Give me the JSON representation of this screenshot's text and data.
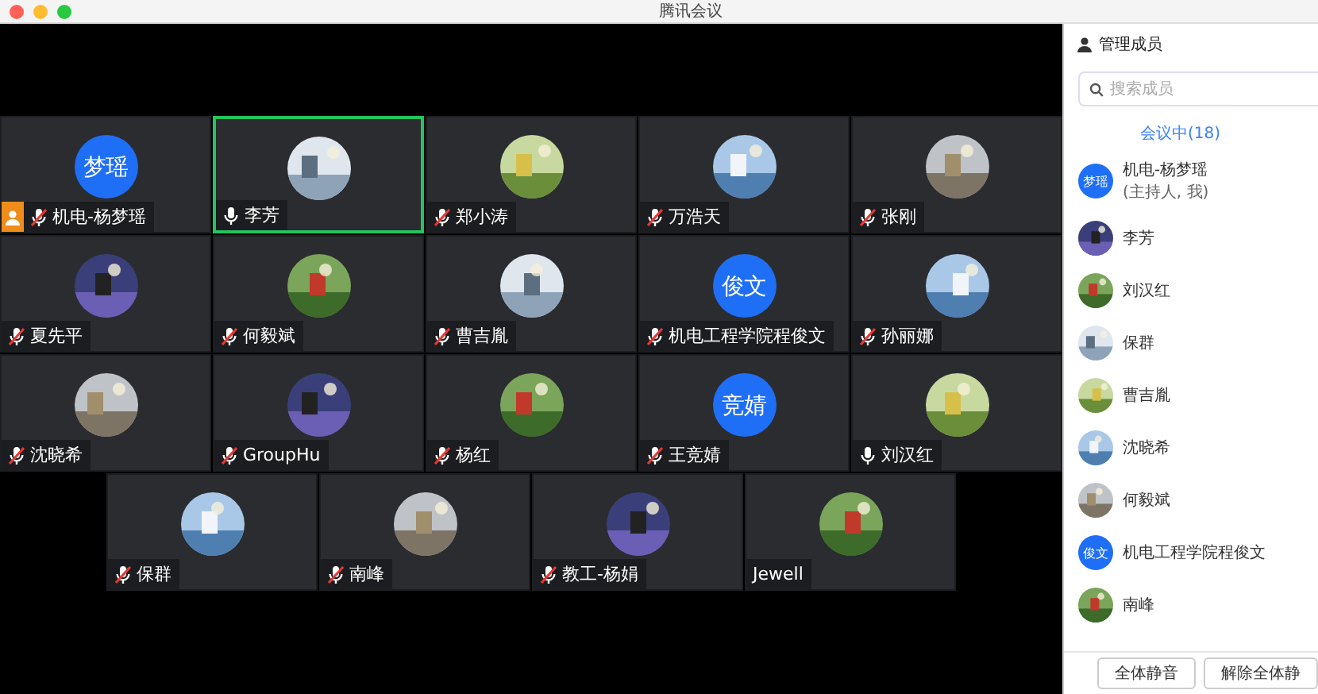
{
  "window": {
    "title": "腾讯会议"
  },
  "grid_rows": [
    {
      "tiles": [
        {
          "name": "机电-杨梦瑶",
          "avatar": {
            "kind": "text",
            "text": "梦瑶"
          },
          "host": true,
          "mic_muted": true,
          "active_speaker": false
        },
        {
          "name": "李芳",
          "host": false,
          "mic_muted": false,
          "active_speaker": true
        },
        {
          "name": "郑小涛",
          "host": false,
          "mic_muted": true,
          "active_speaker": false
        },
        {
          "name": "万浩天",
          "host": false,
          "mic_muted": true,
          "active_speaker": false
        },
        {
          "name": "张刚",
          "host": false,
          "mic_muted": true,
          "active_speaker": false
        }
      ]
    },
    {
      "tiles": [
        {
          "name": "夏先平",
          "host": false,
          "mic_muted": true,
          "active_speaker": false
        },
        {
          "name": "何毅斌",
          "host": false,
          "mic_muted": true,
          "active_speaker": false
        },
        {
          "name": "曹吉胤",
          "host": false,
          "mic_muted": true,
          "active_speaker": false
        },
        {
          "name": "机电工程学院程俊文",
          "avatar": {
            "kind": "text",
            "text": "俊文"
          },
          "host": false,
          "mic_muted": true,
          "active_speaker": false
        },
        {
          "name": "孙丽娜",
          "host": false,
          "mic_muted": true,
          "active_speaker": false
        }
      ]
    },
    {
      "tiles": [
        {
          "name": "沈晓希",
          "host": false,
          "mic_muted": true,
          "active_speaker": false
        },
        {
          "name": "GroupHu",
          "host": false,
          "mic_muted": true,
          "active_speaker": false
        },
        {
          "name": "杨红",
          "host": false,
          "mic_muted": true,
          "active_speaker": false
        },
        {
          "name": "王竞婧",
          "avatar": {
            "kind": "text",
            "text": "竞婧"
          },
          "host": false,
          "mic_muted": true,
          "active_speaker": false
        },
        {
          "name": "刘汉红",
          "host": false,
          "mic_muted": false,
          "active_speaker": false
        }
      ]
    },
    {
      "tiles": [
        {
          "name": "保群",
          "host": false,
          "mic_muted": true,
          "active_speaker": false
        },
        {
          "name": "南峰",
          "host": false,
          "mic_muted": true,
          "active_speaker": false
        },
        {
          "name": "教工-杨娟",
          "host": false,
          "mic_muted": true,
          "active_speaker": false
        },
        {
          "name": "Jewell",
          "host": false,
          "active_speaker": false
        }
      ]
    }
  ],
  "sidebar": {
    "title": "管理成员",
    "search": {
      "placeholder": "搜索成员"
    },
    "tabs": [
      {
        "label": "会议中(18)",
        "selected": true
      }
    ],
    "members": [
      {
        "name": "机电-杨梦瑶",
        "note": "(主持人, 我)",
        "avatar": {
          "kind": "text",
          "text": "梦瑶"
        }
      },
      {
        "name": "李芳"
      },
      {
        "name": "刘汉红"
      },
      {
        "name": "保群"
      },
      {
        "name": "曹吉胤"
      },
      {
        "name": "沈晓希"
      },
      {
        "name": "何毅斌"
      },
      {
        "name": "机电工程学院程俊文",
        "avatar": {
          "kind": "text",
          "text": "俊文"
        }
      },
      {
        "name": "南峰"
      }
    ],
    "buttons": [
      "全体静音",
      "解除全体静"
    ]
  }
}
